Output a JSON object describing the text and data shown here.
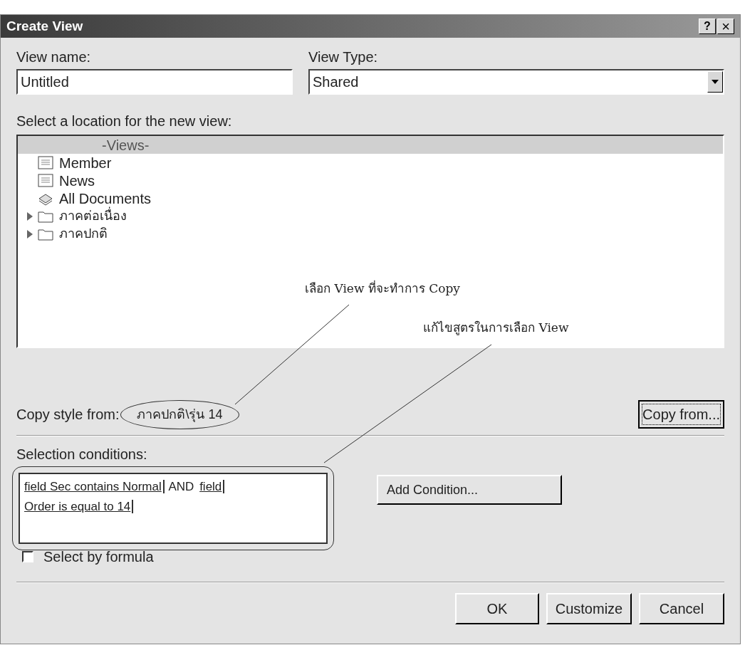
{
  "window": {
    "title": "Create View",
    "help_button": "?",
    "close_button": "×"
  },
  "view_name": {
    "label": "View name:",
    "value": "Untitled"
  },
  "view_type": {
    "label": "View Type:",
    "value": "Shared"
  },
  "location": {
    "label": "Select a location for the new view:",
    "items": [
      {
        "label": "-Views-",
        "kind": "header",
        "selected": true
      },
      {
        "label": "Member",
        "kind": "view",
        "selected": false
      },
      {
        "label": "News",
        "kind": "view",
        "selected": false
      },
      {
        "label": "All Documents",
        "kind": "documents",
        "selected": false
      },
      {
        "label": "ภาคต่อเนื่อง",
        "kind": "folder",
        "selected": false,
        "expanded": false
      },
      {
        "label": "ภาคปกติ",
        "kind": "folder",
        "selected": false,
        "expanded": false
      }
    ]
  },
  "copy_style": {
    "label": "Copy style from:",
    "value": "ภาคปกติ\\รุ่น 14",
    "button": "Copy from..."
  },
  "selection": {
    "label": "Selection conditions:",
    "tokens": [
      {
        "text": "field Sec contains Normal",
        "kind": "condition"
      },
      {
        "text": "AND",
        "kind": "operator"
      },
      {
        "text": "field",
        "kind": "condition"
      },
      {
        "text": "Order is equal to 14",
        "kind": "condition"
      }
    ],
    "add_button": "Add Condition...",
    "formula": {
      "label": "Select by formula",
      "checked": false
    }
  },
  "annotations": [
    {
      "text": "เลือก View ที่จะทำการ Copy"
    },
    {
      "text": "แก้ไขสูตรในการเลือก View"
    }
  ],
  "buttons": [
    "OK",
    "Customize",
    "Cancel"
  ]
}
